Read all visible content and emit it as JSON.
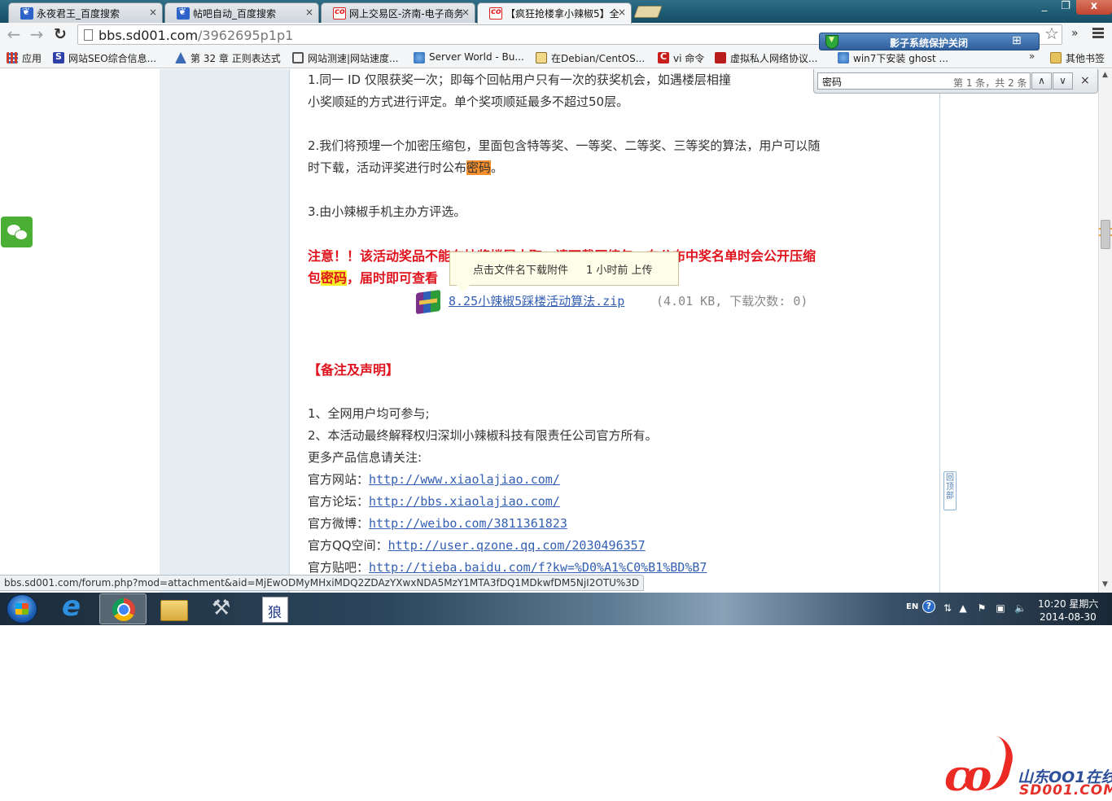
{
  "browser": {
    "tabs": [
      {
        "label": "永夜君王_百度搜索",
        "icon": "baidu-paw-icon",
        "active": false
      },
      {
        "label": "帖吧自动_百度搜索",
        "icon": "baidu-paw-icon",
        "active": false
      },
      {
        "label": "网上交易区-济南-电子商务",
        "icon": "sd001-icon",
        "active": false
      },
      {
        "label": "【疯狂抢楼拿小辣椒5】全",
        "icon": "sd001-icon",
        "active": true
      }
    ],
    "tab_close_glyph": "×",
    "window_controls": {
      "minimize": "_",
      "maximize": "❐",
      "close": "x"
    },
    "url_domain": "bbs.sd001.com",
    "url_path": "/3962695p1p1",
    "bookmarks": [
      {
        "label": "应用",
        "icon": "apps-grid-icon"
      },
      {
        "label": "网站SEO综合信息...",
        "icon": "seo-s-icon"
      },
      {
        "label": "第 32 章 正则表达式",
        "icon": "book-icon"
      },
      {
        "label": "网站测速|网站速度...",
        "icon": "eye-icon"
      },
      {
        "label": "Server World - Bu...",
        "icon": "globe-icon"
      },
      {
        "label": "在Debian/CentOS...",
        "icon": "note-icon"
      },
      {
        "label": "vi 命令",
        "icon": "c-icon"
      },
      {
        "label": "虚拟私人网络协议...",
        "icon": "pdf-icon"
      },
      {
        "label": "win7下安装 ghost ...",
        "icon": "wiki-icon"
      }
    ],
    "bookmarks_overflow": "»",
    "other_bookmarks": "其他书签",
    "extension": {
      "title": "影子系统保护关闭"
    },
    "find": {
      "query": "密码",
      "count": "第 1 条，共 2 条",
      "prev": "∧",
      "next": "∨",
      "close": "×"
    },
    "status_url": "bbs.sd001.com/forum.php?mod=attachment&aid=MjEwODMyMHxiMDQ2ZDAzYXwxNDA5MzY1MTA3fDQ1MDkwfDM5NjI2OTU%3D"
  },
  "post": {
    "rule1_a": "1.同一 ID 仅限获奖一次；即每个回帖用户只有一次的获奖机会，如遇楼层相撞",
    "rule1_b": "小奖顺延的方式进行评定。单个奖项顺延最多不超过50层。",
    "rule2_a": "2.我们将预埋一个加密压缩包，里面包含特等奖、一等奖、二等奖、三等奖的算法，用户可以随",
    "rule2_b_pre": "时下载，活动评奖进行时公布",
    "rule2_b_hl": "密码",
    "rule2_b_post": "。",
    "rule3": "3.由小辣椒手机主办方评选。",
    "notice_a": "注意！！该活动奖品不能在抽奖楼层中取，请下载压缩包，在公布中奖名单时会公开压缩",
    "notice_b_pre": "包",
    "notice_b_hl": "密码",
    "notice_b_post": "，届时即可查看",
    "tooltip_text": "点击文件名下载附件",
    "tooltip_time": "1 小时前 上传",
    "attachment_name": "8.25小辣椒5踩楼活动算法.zip",
    "attachment_meta": "(4.01 KB, 下载次数: 0)",
    "remarks_title": "【备注及声明】",
    "remark1": "1、全网用户均可参与;",
    "remark2": "2、本活动最终解释权归深圳小辣椒科技有限责任公司官方所有。",
    "more_info": "更多产品信息请关注:",
    "links": [
      {
        "label": "官方网站：",
        "url": "http://www.xiaolajiao.com/"
      },
      {
        "label": "官方论坛：",
        "url": "http://bbs.xiaolajiao.com/"
      },
      {
        "label": "官方微博：",
        "url": "http://weibo.com/3811361823"
      },
      {
        "label": "官方QQ空间：",
        "url": "http://user.qzone.qq.com/2030496357"
      },
      {
        "label": "官方贴吧：",
        "url": "http://tieba.baidu.com/f?kw=%D0%A1%C0%B1%BD%B7"
      }
    ],
    "back_to_top": "回顶部"
  },
  "taskbar": {
    "lang": "EN",
    "help": "?",
    "time": "10:20 星期六",
    "date": "2014-08-30",
    "apps": [
      "ie-icon",
      "chrome-icon",
      "explorer-icon",
      "tools-icon",
      "input-method-icon"
    ],
    "ime_glyph": "狼"
  },
  "watermark": {
    "logo": "co",
    "cn": "山东OO1在线",
    "en": "SD001.COM"
  }
}
